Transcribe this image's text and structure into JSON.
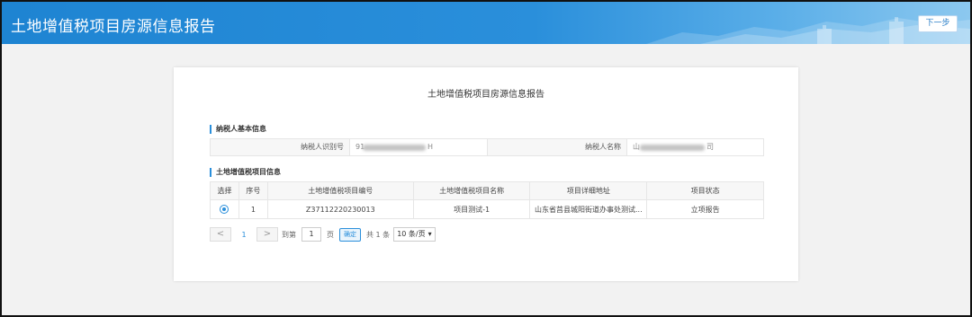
{
  "header": {
    "title": "土地增值税项目房源信息报告",
    "next_label": "下一步"
  },
  "card": {
    "title": "土地增值税项目房源信息报告",
    "taxpayer_section": "纳税人基本信息",
    "taxpayer_id_label": "纳税人识别号",
    "taxpayer_id_value": "91",
    "taxpayer_id_tail": "H",
    "taxpayer_name_label": "纳税人名称",
    "taxpayer_name_value": "山",
    "taxpayer_name_tail": "司",
    "project_section": "土地增值税项目信息"
  },
  "table": {
    "headers": [
      "选择",
      "序号",
      "土地增值税项目编号",
      "土地增值税项目名称",
      "项目详细地址",
      "项目状态"
    ],
    "rows": [
      {
        "index": "1",
        "project_no": "Z37112220230013",
        "project_name": "项目测试-1",
        "address": "山东省莒县城阳街道办事处测试...",
        "status": "立项报告"
      }
    ]
  },
  "pager": {
    "prev": "<",
    "current_page": "1",
    "next": ">",
    "goto_label": "到第",
    "goto_value": "1",
    "page_unit": "页",
    "confirm_label": "确定",
    "total": "共 1 条",
    "page_size": "10 条/页",
    "dropdown_icon": "▾"
  },
  "colors": {
    "accent": "#2a8fdb",
    "header_bg": "#1e84d2"
  }
}
